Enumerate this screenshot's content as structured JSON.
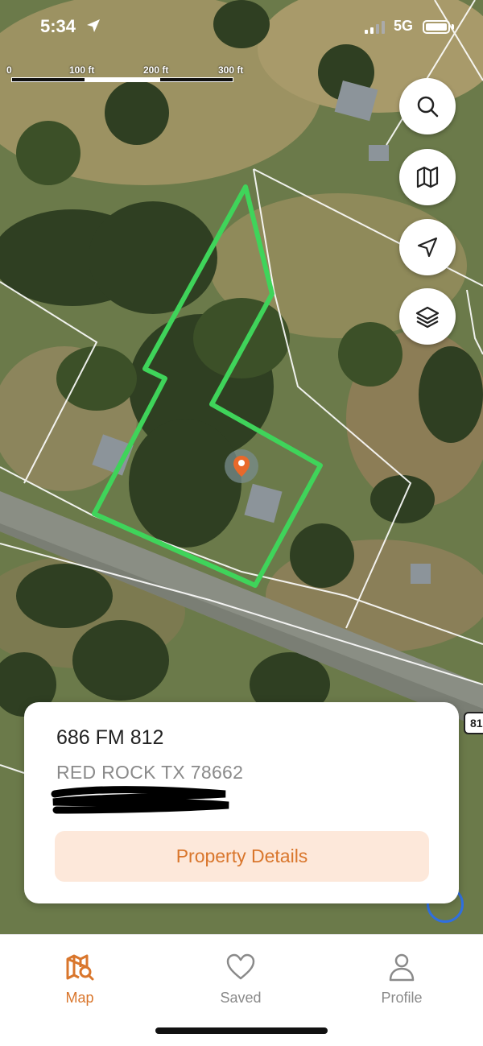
{
  "status_bar": {
    "time": "5:34",
    "network": "5G"
  },
  "scale": {
    "labels": [
      "0",
      "100 ft",
      "200 ft",
      "300 ft"
    ]
  },
  "map_buttons": [
    {
      "icon": "search-icon"
    },
    {
      "icon": "map-icon"
    },
    {
      "icon": "navigate-arrow-icon"
    },
    {
      "icon": "layers-icon"
    }
  ],
  "road_marker": {
    "label": "81"
  },
  "property_card": {
    "address_line1": "686 FM 812",
    "address_line2": "RED ROCK TX 78662",
    "details_button": "Property Details",
    "accent_color": "#d9762c"
  },
  "tab_bar": {
    "active_color": "#d9762c",
    "inactive_color": "#8a8a8a",
    "tabs": [
      {
        "label": "Map",
        "icon": "map-search-icon",
        "active": true
      },
      {
        "label": "Saved",
        "icon": "heart-icon",
        "active": false
      },
      {
        "label": "Profile",
        "icon": "person-icon",
        "active": false
      }
    ]
  }
}
